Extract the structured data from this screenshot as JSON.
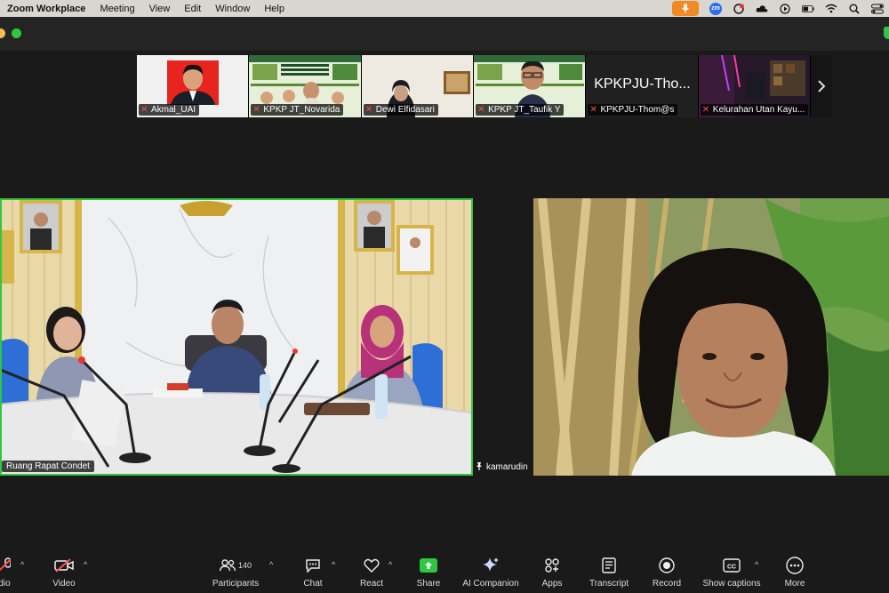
{
  "menubar": {
    "app": "Zoom Workplace",
    "items": [
      "Meeting",
      "View",
      "Edit",
      "Window",
      "Help"
    ],
    "zm_badge": "zm"
  },
  "gallery": [
    {
      "name": "Akmal_UAI"
    },
    {
      "name": "KPKP JT_Novarida"
    },
    {
      "name": "Dewi Elfidasari"
    },
    {
      "name": "KPKP JT_Taufik Y"
    },
    {
      "name": "KPKPJU-Thom@s",
      "display": "KPKPJU-Tho..."
    },
    {
      "name": "Kelurahan Utan Kayu..."
    }
  ],
  "gallery_poster": {
    "title": "BEDAH BUKU",
    "subtitle": "Dari Sungai ke Literasi: Membangun Kesadaran Lingkungan Melalui Fenomena Ikan Sapu-sapu"
  },
  "tiles": [
    {
      "name": "Ruang Rapat Condet",
      "visible_name": "Ruang Rapat Condet"
    },
    {
      "name": "kamarudin"
    }
  ],
  "toolbar": {
    "audio": "Audio",
    "audio_visible": "dio",
    "video": "Video",
    "participants": "Participants",
    "participants_count": "140",
    "chat": "Chat",
    "react": "React",
    "share": "Share",
    "ai": "AI Companion",
    "apps": "Apps",
    "transcript": "Transcript",
    "record": "Record",
    "captions": "Show captions",
    "more": "More"
  },
  "colors": {
    "active_speaker": "#2dc840",
    "mic_pill": "#f08a24",
    "share_green": "#2dc840",
    "muted": "#ff4b4b"
  }
}
